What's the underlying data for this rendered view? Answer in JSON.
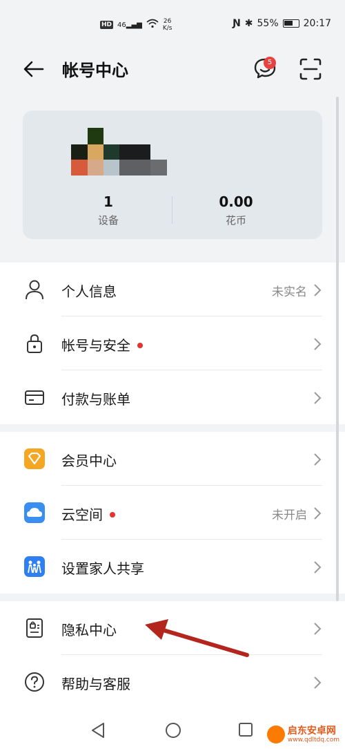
{
  "status_bar": {
    "hd_label": "HD",
    "net_label": "46",
    "speed_value": "26",
    "speed_unit": "K/s",
    "battery_percent": "55%",
    "time": "20:17"
  },
  "header": {
    "title": "帐号中心",
    "message_badge": "5"
  },
  "profile_card": {
    "devices_value": "1",
    "devices_label": "设备",
    "coins_value": "0.00",
    "coins_label": "花币"
  },
  "menu_group_1": [
    {
      "label": "个人信息",
      "value": "未实名",
      "icon": "person-icon",
      "dot": false
    },
    {
      "label": "帐号与安全",
      "value": "",
      "icon": "lock-icon",
      "dot": true
    },
    {
      "label": "付款与账单",
      "value": "",
      "icon": "card-icon",
      "dot": false
    }
  ],
  "menu_group_2": [
    {
      "label": "会员中心",
      "value": "",
      "icon": "vip-icon",
      "dot": false
    },
    {
      "label": "云空间",
      "value": "未开启",
      "icon": "cloud-icon",
      "dot": true
    },
    {
      "label": "设置家人共享",
      "value": "",
      "icon": "family-icon",
      "dot": false
    }
  ],
  "menu_group_3": [
    {
      "label": "隐私中心",
      "value": "",
      "icon": "privacy-icon",
      "dot": false
    },
    {
      "label": "帮助与客服",
      "value": "",
      "icon": "help-icon",
      "dot": false
    }
  ],
  "watermark": {
    "name": "启东安卓网",
    "url": "www.qdltdq.com"
  },
  "colors": {
    "background": "#f1f3f5",
    "card": "#e3e8ed",
    "red_dot": "#e3342f",
    "badge": "#e64340",
    "annotation_arrow": "#b3261e"
  }
}
